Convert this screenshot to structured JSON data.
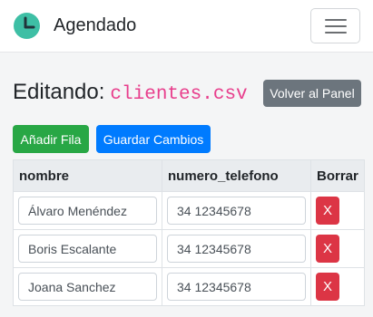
{
  "navbar": {
    "brand": "Agendado",
    "brand_icon": "clock-icon",
    "menu_icon": "hamburger-menu-icon"
  },
  "heading": {
    "prefix": "Editando:",
    "filename": "clientes.csv"
  },
  "buttons": {
    "back": "Volver al Panel",
    "add_row": "Añadir Fila",
    "save": "Guardar Cambios"
  },
  "table": {
    "headers": [
      "nombre",
      "numero_telefono",
      "Borrar"
    ],
    "rows": [
      {
        "nombre": "Álvaro Menéndez",
        "telefono": "34 12345678",
        "delete": "X"
      },
      {
        "nombre": "Boris Escalante",
        "telefono": "34 12345678",
        "delete": "X"
      },
      {
        "nombre": "Joana Sanchez",
        "telefono": "34 12345678",
        "delete": "X"
      }
    ]
  },
  "colors": {
    "back_button": "#6c757d",
    "add_button": "#28a745",
    "save_button": "#007bff",
    "delete_button": "#dc3545",
    "filename": "#e83e8c",
    "logo": "#3ebfa5"
  }
}
